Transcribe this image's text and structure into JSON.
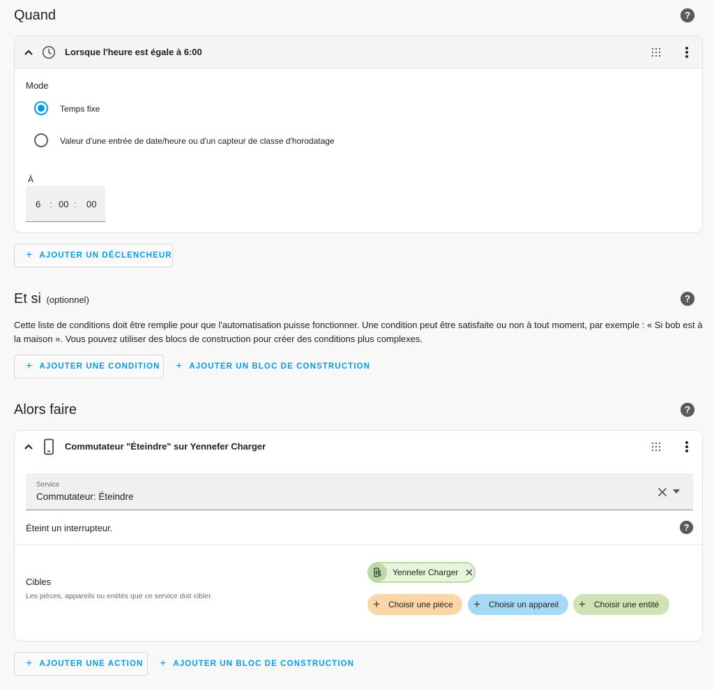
{
  "triggers": {
    "title": "Quand",
    "card": {
      "title": "Lorsque l'heure est égale à 6:00",
      "mode_label": "Mode",
      "options": [
        {
          "label": "Temps fixe",
          "checked": true
        },
        {
          "label": "Valeur d'une entrée de date/heure ou d'un capteur de classe d'horodatage",
          "checked": false
        }
      ],
      "at_label": "À",
      "time": {
        "hours": "6",
        "minutes": "00",
        "seconds": "00",
        "separator": ":"
      }
    },
    "add_button": "AJOUTER UN DÉCLENCHEUR"
  },
  "conditions": {
    "title": "Et si",
    "optional": "(optionnel)",
    "description": "Cette liste de conditions doit être remplie pour que l'automatisation puisse fonctionner. Une condition peut être satisfaite ou non à tout moment, par exemple : « Si bob est à la maison ». Vous pouvez utiliser des blocs de construction pour créer des conditions plus complexes.",
    "add_button": "AJOUTER UNE CONDITION",
    "add_block_button": "AJOUTER UN BLOC DE CONSTRUCTION"
  },
  "actions": {
    "title": "Alors faire",
    "card": {
      "title": "Commutateur \"Éteindre\" sur Yennefer Charger",
      "service_label": "Service",
      "service_value": "Commutateur: Éteindre",
      "service_description": "Éteint un interrupteur.",
      "targets_label": "Cibles",
      "targets_description": "Les pièces, appareils ou entités que ce service doit cibler.",
      "selected_target": "Yennefer Charger",
      "choose_room": "Choisir une pièce",
      "choose_device": "Choisir un appareil",
      "choose_entity": "Choisir une entité"
    },
    "add_button": "AJOUTER UNE ACTION",
    "add_block_button": "AJOUTER UN BLOC DE CONSTRUCTION"
  },
  "colors": {
    "accent": "#039be5",
    "room_chip": "#fad6a8",
    "device_chip": "#a6d9f5",
    "entity_chip": "#cfe3b5",
    "target_chip_bg": "#e8f4dc",
    "target_chip_border": "#b7dba0"
  },
  "icons": {
    "help": "help-circle-icon",
    "collapse": "chevron-up-icon",
    "clock": "clock-icon",
    "phone": "cellphone-icon",
    "drag": "drag-handle-icon",
    "menu": "dots-vertical-icon",
    "clear": "close-icon",
    "dropdown": "menu-down-icon",
    "charger": "ev-charger-icon",
    "plus": "plus-icon"
  }
}
